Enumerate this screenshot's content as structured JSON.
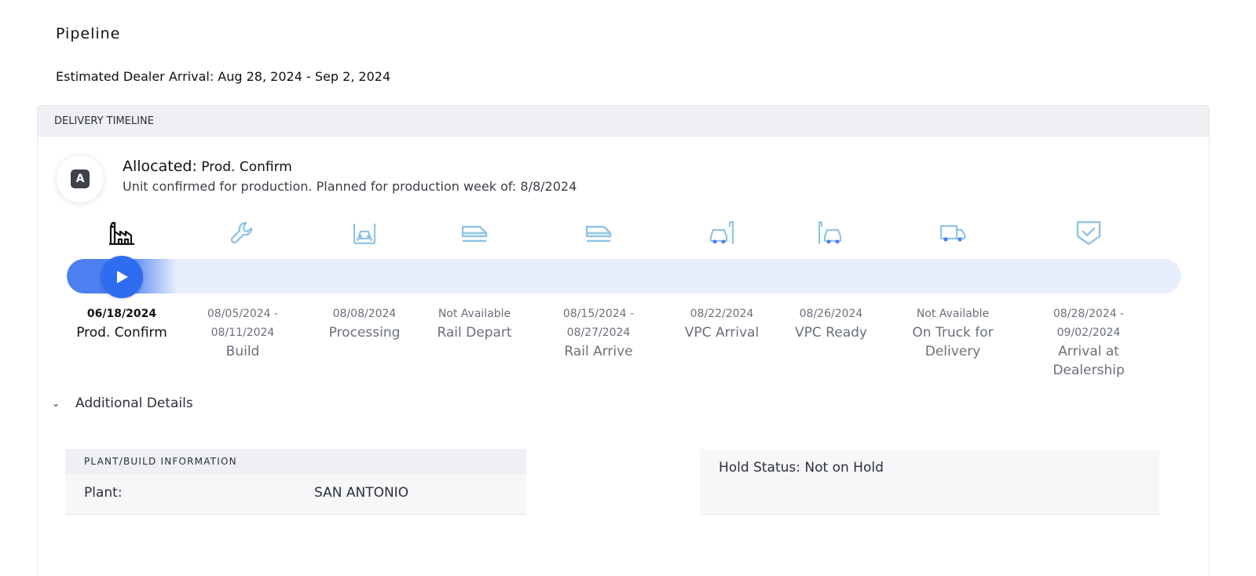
{
  "page": {
    "title": "Pipeline",
    "eta": "Estimated Dealer Arrival: Aug 28, 2024 - Sep 2, 2024"
  },
  "timeline": {
    "header": "DELIVERY TIMELINE",
    "badge_letter": "A",
    "status_prefix": "Allocated:",
    "status_value": "Prod. Confirm",
    "status_description": "Unit confirmed for production. Planned for production week of: 8/8/2024",
    "progress_step_index": 0,
    "colors": {
      "accent": "#2f6df0",
      "track": "#e7eefc",
      "inactive_icon": "#8fc4e8",
      "active_icon": "#111111"
    },
    "steps": [
      {
        "icon": "factory-icon",
        "date": "06/18/2024",
        "label": "Prod. Confirm"
      },
      {
        "icon": "wrench-icon",
        "date": "08/05/2024 -\n08/11/2024",
        "label": "Build"
      },
      {
        "icon": "processing-icon",
        "date": "08/08/2024",
        "label": "Processing"
      },
      {
        "icon": "rail-depart-icon",
        "date": "Not Available",
        "label": "Rail Depart"
      },
      {
        "icon": "rail-arrive-icon",
        "date": "08/15/2024 -\n08/27/2024",
        "label": "Rail Arrive"
      },
      {
        "icon": "vpc-arrival-icon",
        "date": "08/22/2024",
        "label": "VPC Arrival"
      },
      {
        "icon": "vpc-ready-icon",
        "date": "08/26/2024",
        "label": "VPC Ready"
      },
      {
        "icon": "truck-icon",
        "date": "Not Available",
        "label": "On Truck for\nDelivery"
      },
      {
        "icon": "shield-check-icon",
        "date": "08/28/2024 -\n09/02/2024",
        "label": "Arrival at\nDealership"
      }
    ]
  },
  "details": {
    "toggle_label": "Additional Details",
    "plant_header": "PLANT/BUILD INFORMATION",
    "plant_key": "Plant:",
    "plant_value": "SAN ANTONIO",
    "hold_status": "Hold Status: Not on Hold"
  }
}
